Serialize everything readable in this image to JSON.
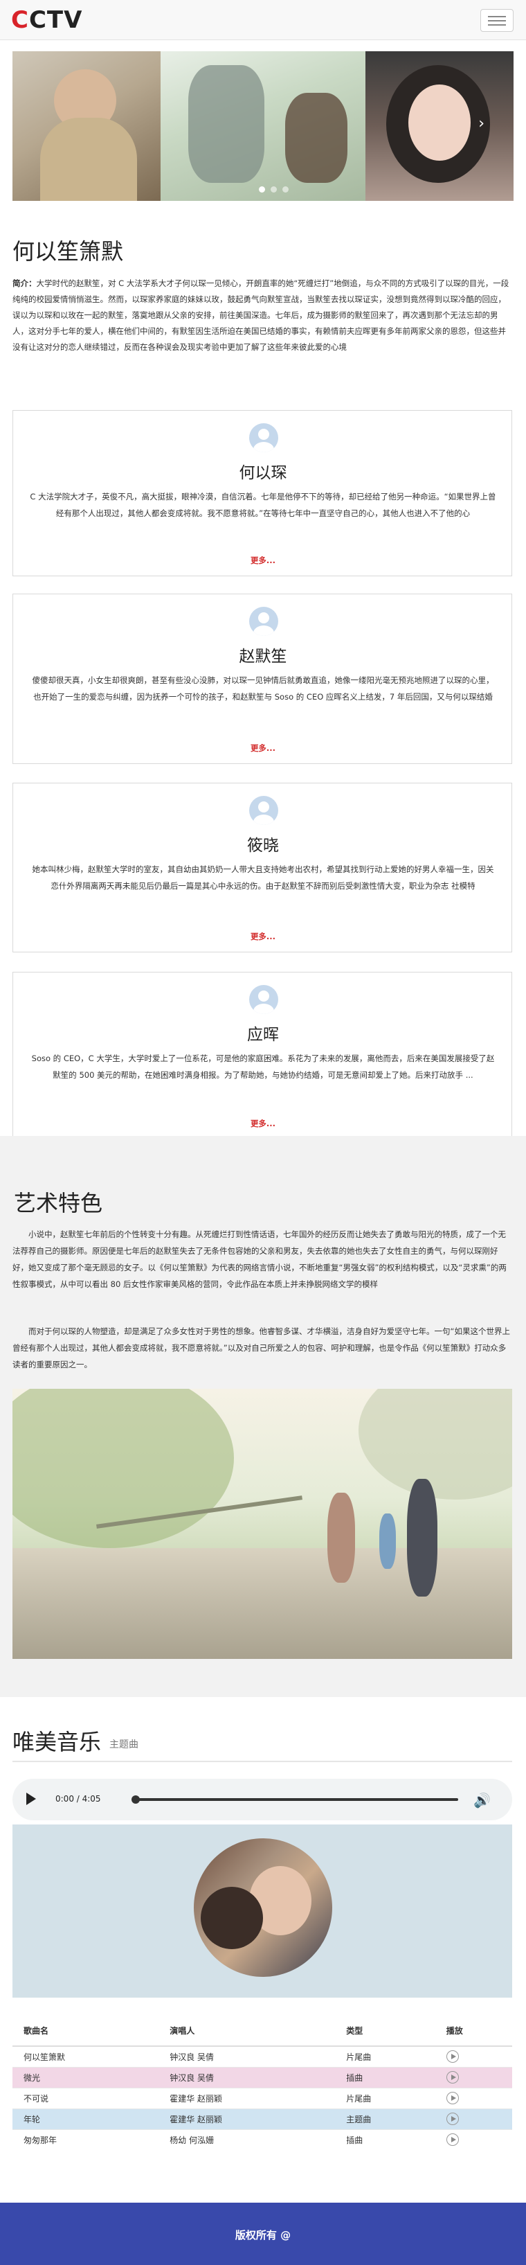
{
  "header": {
    "logo": {
      "c1": "C",
      "c2": "C",
      "t": "T",
      "v": "V"
    },
    "menu_button": "menu-icon"
  },
  "carousel": {
    "slides": [
      "slide-1",
      "slide-2",
      "slide-3"
    ],
    "active_index": 0
  },
  "intro": {
    "title": "何以笙箫默",
    "label": "简介：",
    "text": "大学时代的赵默笙，对 C 大法学系大才子何以琛一见倾心，开朗直率的她“死缠烂打”地倒追，与众不同的方式吸引了以琛的目光，一段纯纯的校园爱情悄悄滋生。然而，以琛家养家庭的妹妹以玫，鼓起勇气向默笙宣战，当默笙去找以琛证实，没想到竟然得到以琛冷酷的回应，误以为以琛和以玫在一起的默笙，落寞地跟从父亲的安排，前往美国深造。七年后，成为摄影师的默笙回来了，再次遇到那个无法忘却的男人，这对分手七年的爱人，横在他们中间的，有默笙因生活所迫在美国已结婚的事实，有赖情前夫应晖更有多年前两家父亲的恩怨，但这些并没有让这对分的恋人继续错过，反而在各种误会及现实考验中更加了解了这些年来彼此爱的心境"
  },
  "characters": [
    {
      "name": "何以琛",
      "text": "C 大法学院大才子，英俊不凡，高大挺拔，眼神冷漠，自信沉着。七年是他停不下的等待，却已经给了他另一种命运。“如果世界上曾经有那个人出现过，其他人都会变成将就。我不愿意将就。”在等待七年中一直坚守自己的心，其他人也进入不了他的心",
      "more": "更多..."
    },
    {
      "name": "赵默笙",
      "text": "傻傻却很天真，小女生却很爽朗，甚至有些没心没肺，对以琛一见钟情后就勇敢直追，她像一缕阳光毫无预兆地照进了以琛的心里，也开始了一生的爱恋与纠缠，因为抚养一个可怜的孩子，和赵默笙与 Soso 的 CEO 应晖名义上结发，7 年后回国，又与何以琛结婚",
      "more": "更多..."
    },
    {
      "name": "筱晓",
      "text": "她本叫林少梅，赵默笙大学时的室友，其自幼由其奶奶一人带大且支持她考出农村，希望其找到行动上爱她的好男人幸福一生，因关恋什外界隔离两天再未能见后仍最后一篇是其心中永远的伤。由于赵默笙不辞而别后受刺激性情大变，职业为杂志 社模特",
      "more": "更多..."
    },
    {
      "name": "应晖",
      "text": "Soso 的 CEO，C 大学生，大学时爱上了一位系花，可是他的家庭困难。系花为了未来的发展，离他而去，后来在美国发展接受了赵默笙的 500 美元的帮助，在她困难时满身相报。为了帮助她，与她协约结婚，可是无意间却爱上了她。后来打动放手 ...",
      "more": "更多..."
    }
  ],
  "art": {
    "title": "艺术特色",
    "p1": "小说中，赵默笙七年前后的个性转变十分有趣。从死缠烂打到性情话语，七年国外的经历反而让她失去了勇敢与阳光的特质，成了一个无法荐荐自己的摄影师。原因便是七年后的赵默笙失去了无条件包容她的父亲和男友，失去依靠的她也失去了女性自主的勇气，与何以琛刚好好，她又变成了那个毫无顾忌的女子。以《何以笙箫默》为代表的网络言情小说，不断地重复“男强女弱”的权利结构模式，以及“灵求熏”的两性叙事模式，从中可以看出 80 后女性作家审美风格的营同，令此作品在本质上并未挣脱网络文学的模样",
    "p2": "而对于何以琛的人物塑造，却是满足了众多女性对于男性的想象。他睿智多谋、才华横溢，洁身自好为爱坚守七年。一句“如果这个世界上曾经有那个人出现过，其他人都会变成将就，我不愿意将就。”以及对自己所爱之人的包容、呵护和理解，也是令作品《何以笙箫默》打动众多读者的重要原因之一。"
  },
  "music": {
    "title": "唯美音乐",
    "subtitle": "主题曲",
    "player": {
      "time": "0:00 / 4:05",
      "progress": 0.0
    },
    "table": {
      "headers": [
        "歌曲名",
        "演唱人",
        "类型",
        "播放"
      ],
      "rows": [
        [
          "何以笙箫默",
          "钟汉良 吴倩",
          "片尾曲"
        ],
        [
          "微光",
          "钟汉良 吴倩",
          "插曲"
        ],
        [
          "不可说",
          "霍建华 赵丽颖",
          "片尾曲"
        ],
        [
          "年轮",
          "霍建华 赵丽颖",
          "主题曲"
        ],
        [
          "匆匆那年",
          "杨幼 何泓姗",
          "插曲"
        ]
      ],
      "row_colors": [
        "#ffffff",
        "#f2d7e6",
        "#ffffff",
        "#d0e4f2",
        "#ffffff"
      ]
    }
  },
  "footer": {
    "text": "版权所有 @"
  },
  "colors": {
    "logo_red": "#d8232a",
    "more_red": "#d32f2f",
    "footer_bg": "#3949ab"
  }
}
